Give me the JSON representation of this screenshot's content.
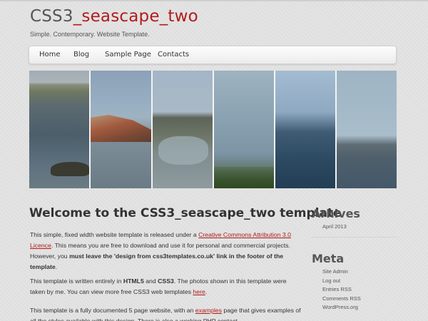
{
  "site": {
    "title_main": "CSS3",
    "title_accent": "_seascape_two",
    "tagline": "Simple. Contemporary. Website Template."
  },
  "nav": {
    "items": [
      {
        "label": "Home"
      },
      {
        "label": "Blog"
      },
      {
        "label": "Sample Page"
      },
      {
        "label": "Contacts"
      }
    ]
  },
  "content": {
    "heading": "Welcome to the CSS3_seascape_two template",
    "p1": {
      "t1": "This simple, fixed width website template is released under a ",
      "link1": "Creative Commons Attribution 3.0 Licence",
      "t2": ". This means you are free to download and use it for personal and commercial projects. However, you ",
      "bold1": "must leave the 'design from css3templates.co.uk' link in the footer of the template",
      "t3": "."
    },
    "p2": {
      "t1": "This template is written entirely in ",
      "bold1": "HTML5",
      "t2": " and ",
      "bold2": "CSS3",
      "t3": ". The photos shown in this template were taken by me. You can view more free CSS3 web templates ",
      "link1": "here",
      "t4": "."
    },
    "p3": {
      "t1": "This template is a fully documented 5 page website, with an ",
      "link1": "examples",
      "t2": " page that gives examples of all the styles available with this design. There is also a working PHP contact"
    }
  },
  "sidebar": {
    "archives_title": "Arhives",
    "archives": [
      "April 2013"
    ],
    "meta_title": "Meta",
    "meta": [
      "Site Admin",
      "Log out",
      "Entries RSS",
      "Comments RSS",
      "WordPress.org"
    ]
  },
  "colors": {
    "accent": "#b01c1c",
    "background": "#e3e3e3"
  }
}
